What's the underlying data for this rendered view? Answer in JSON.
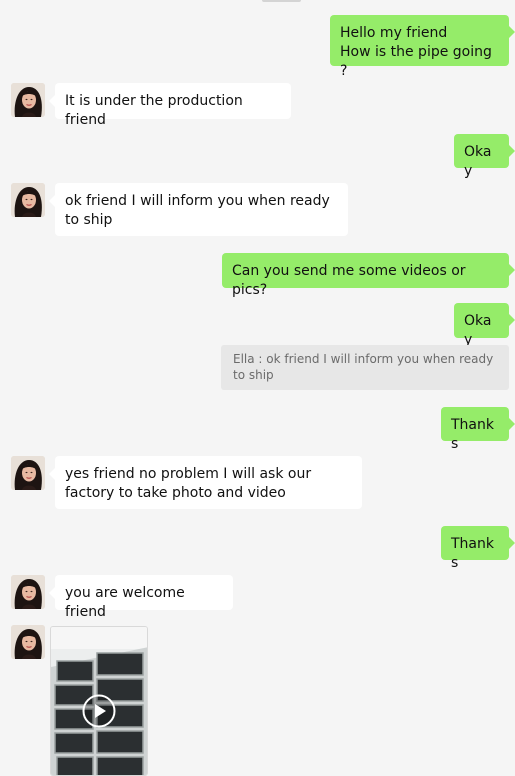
{
  "chat": {
    "messages": [
      {
        "id": "m1",
        "side": "out",
        "text": "Hello my friend\nHow is the pipe going ?"
      },
      {
        "id": "m2",
        "side": "in",
        "text": "It is under the production friend"
      },
      {
        "id": "m3",
        "side": "out",
        "text": "Okay"
      },
      {
        "id": "m4",
        "side": "in",
        "text": "ok friend I will inform you when ready to ship"
      },
      {
        "id": "m5",
        "side": "out",
        "text": "Can you send me some videos or pics?"
      },
      {
        "id": "m6",
        "side": "out",
        "text": "Okay"
      },
      {
        "id": "m7",
        "side": "out",
        "text": "Thanks"
      },
      {
        "id": "m8",
        "side": "in",
        "text": "yes friend no problem I will ask our factory to take photo and video"
      },
      {
        "id": "m9",
        "side": "out",
        "text": "Thanks"
      },
      {
        "id": "m10",
        "side": "in",
        "text": "you are welcome friend"
      }
    ],
    "quote": {
      "text": "Ella : ok friend I will inform you when ready to ship"
    },
    "video": {
      "icon": "play-icon"
    }
  },
  "colors": {
    "background": "#f5f5f5",
    "outgoing_bubble": "#95ec69",
    "incoming_bubble": "#ffffff",
    "quote_bg": "#e7e7e7"
  }
}
